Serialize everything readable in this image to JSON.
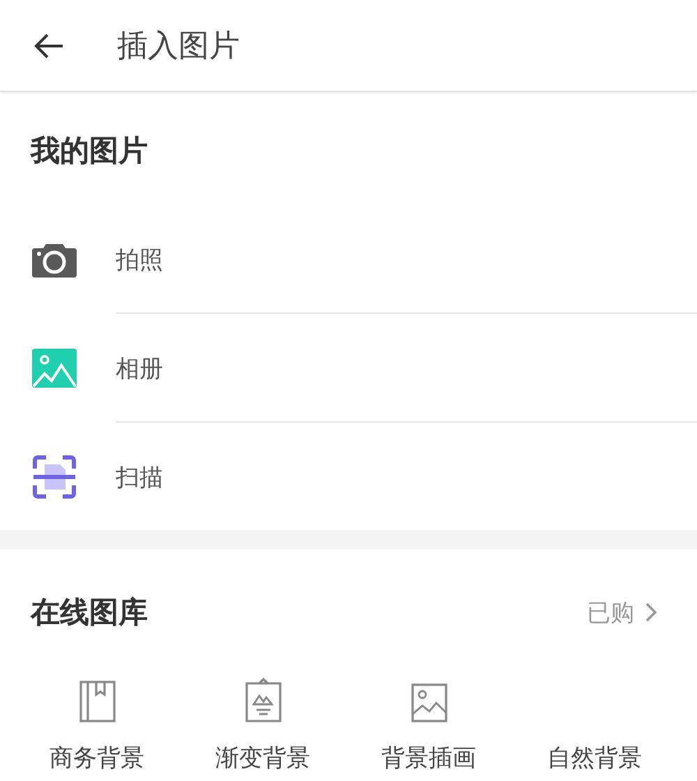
{
  "header": {
    "title": "插入图片"
  },
  "my_pictures": {
    "title": "我的图片",
    "items": [
      {
        "label": "拍照",
        "kind": "camera"
      },
      {
        "label": "相册",
        "kind": "album"
      },
      {
        "label": "扫描",
        "kind": "scan"
      }
    ]
  },
  "online_gallery": {
    "title": "在线图库",
    "link": "已购",
    "categories": [
      {
        "label": "商务背景",
        "kind": "book"
      },
      {
        "label": "渐变背景",
        "kind": "poster"
      },
      {
        "label": "背景插画",
        "kind": "image"
      },
      {
        "label": "自然背景",
        "kind": "hidden"
      }
    ]
  }
}
